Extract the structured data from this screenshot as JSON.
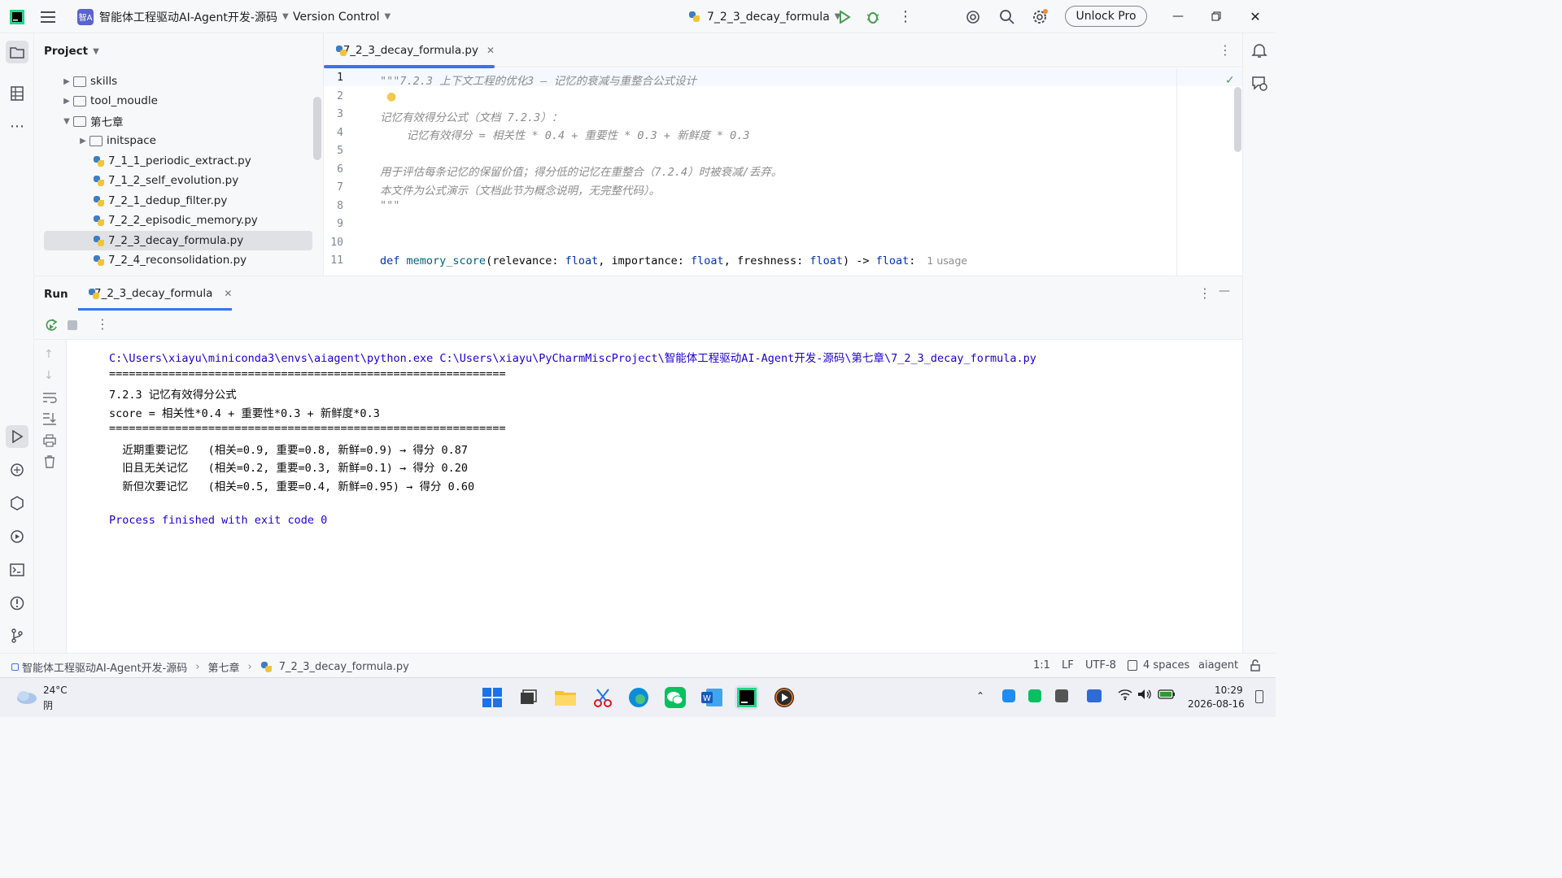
{
  "titlebar": {
    "project_badge": "智A",
    "project_name": "智能体工程驱动AI-Agent开发-源码",
    "vcs_label": "Version Control",
    "run_config": "7_2_3_decay_formula",
    "unlock_label": "Unlock Pro"
  },
  "project_panel": {
    "title": "Project",
    "items": [
      {
        "label": "skills",
        "type": "folder",
        "expanded": false
      },
      {
        "label": "tool_moudle",
        "type": "folder",
        "expanded": false
      },
      {
        "label": "第七章",
        "type": "folder",
        "expanded": true
      },
      {
        "label": "initspace",
        "type": "folder",
        "expanded": false
      },
      {
        "label": "7_1_1_periodic_extract.py",
        "type": "python"
      },
      {
        "label": "7_1_2_self_evolution.py",
        "type": "python"
      },
      {
        "label": "7_2_1_dedup_filter.py",
        "type": "python"
      },
      {
        "label": "7_2_2_episodic_memory.py",
        "type": "python"
      },
      {
        "label": "7_2_3_decay_formula.py",
        "type": "python",
        "selected": true
      },
      {
        "label": "7_2_4_reconsolidation.py",
        "type": "python"
      }
    ]
  },
  "editor": {
    "tab_label": "7_2_3_decay_formula.py",
    "line_numbers": [
      "1",
      "2",
      "3",
      "4",
      "5",
      "6",
      "7",
      "8",
      "9",
      "10",
      "11"
    ],
    "lines": {
      "l1": "\"\"\"7.2.3 上下文工程的优化3 — 记忆的衰减与重整合公式设计",
      "l3": "记忆有效得分公式（文档 7.2.3）：",
      "l4": "    记忆有效得分 = 相关性 * 0.4 + 重要性 * 0.3 + 新鲜度 * 0.3",
      "l6": "用于评估每条记忆的保留价值；得分低的记忆在重整合（7.2.4）时被衰减/丢弃。",
      "l7": "本文件为公式演示（文档此节为概念说明，无完整代码）。",
      "l8": "\"\"\""
    },
    "l11": {
      "def": "def ",
      "fn": "memory_score",
      "p1": "(relevance: ",
      "t": "float",
      "p2": ", importance: ",
      "p3": ", freshness: ",
      "p4": ") -> ",
      "end": ":",
      "usage": "1 usage"
    }
  },
  "run_panel": {
    "title": "Run",
    "tab_label": "7_2_3_decay_formula",
    "console": {
      "cmd": "C:\\Users\\xiayu\\miniconda3\\envs\\aiagent\\python.exe C:\\Users\\xiayu\\PyCharmMiscProject\\智能体工程驱动AI-Agent开发-源码\\第七章\\7_2_3_decay_formula.py",
      "sep1": "============================================================",
      "heading": "7.2.3 记忆有效得分公式",
      "formula": "score = 相关性*0.4 + 重要性*0.3 + 新鲜度*0.3",
      "sep2": "============================================================",
      "r1": "  近期重要记忆   (相关=0.9, 重要=0.8, 新鲜=0.9) → 得分 0.87",
      "r2": "  旧且无关记忆   (相关=0.2, 重要=0.3, 新鲜=0.1) → 得分 0.20",
      "r3": "  新但次要记忆   (相关=0.5, 重要=0.4, 新鲜=0.95) → 得分 0.60",
      "exit": "Process finished with exit code 0"
    }
  },
  "statusbar": {
    "crumb1": "智能体工程驱动AI-Agent开发-源码",
    "crumb2": "第七章",
    "crumb3": "7_2_3_decay_formula.py",
    "position": "1:1",
    "line_sep": "LF",
    "encoding": "UTF-8",
    "indent": "4 spaces",
    "interpreter": "aiagent"
  },
  "taskbar": {
    "temp": "24°C",
    "weather": "阴",
    "time": "10:29",
    "date": "2026-08-16"
  },
  "colors": {
    "accent": "#3574f0",
    "run_green": "#499c54",
    "console_blue": "#1c00cf"
  }
}
